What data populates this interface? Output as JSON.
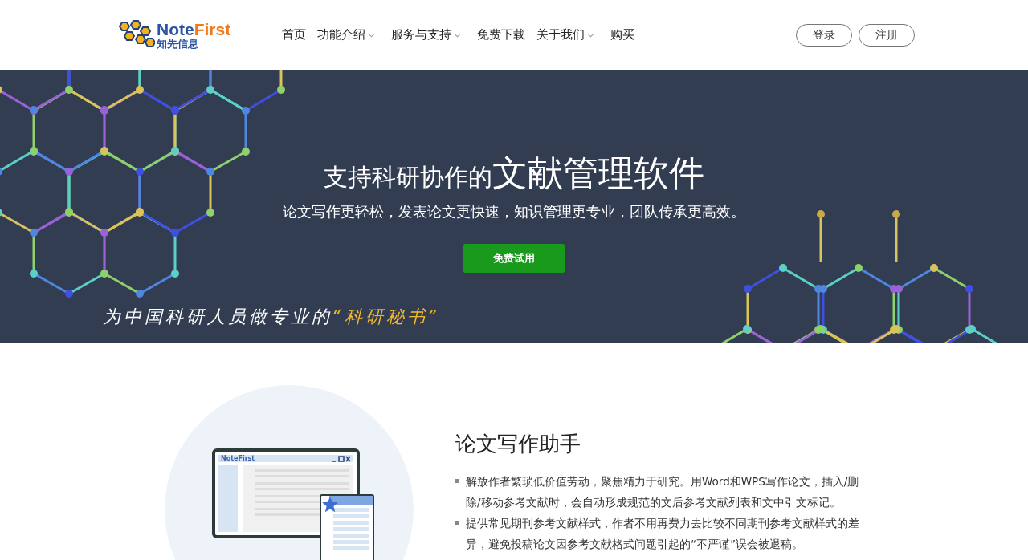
{
  "header": {
    "logo": {
      "name_part1": "Note",
      "name_part2": "First",
      "subtitle": "知先信息"
    },
    "nav": [
      {
        "label": "首页",
        "has_dropdown": false
      },
      {
        "label": "功能介绍",
        "has_dropdown": true
      },
      {
        "label": "服务与支持",
        "has_dropdown": true
      },
      {
        "label": "免费下载",
        "has_dropdown": false
      },
      {
        "label": "关于我们",
        "has_dropdown": true
      },
      {
        "label": "购买",
        "has_dropdown": false
      }
    ],
    "buttons": [
      "登录",
      "注册"
    ]
  },
  "banner": {
    "title_lead": "支持科研协作的",
    "title_main": "文献管理软件",
    "subtitle": "论文写作更轻松，发表论文更快速，知识管理更专业，团队传承更高效。",
    "cta": "免费试用",
    "slogan": "为中国科研人员做专业的",
    "slogan_highlight": "“科研秘书”"
  },
  "feature": {
    "illustration": {
      "window_title": "NoteFirst"
    },
    "heading": "论文写作助手",
    "bullets": [
      "解放作者繁琐低价值劳动，聚焦精力于研究。用Word和WPS写作论文，插入/删除/移动参考文献时，会自动形成规范的文后参考文献列表和文中引文标记。",
      "提供常见期刊参考文献样式，作者不用再费力去比较不同期刊参考文献样式的差异，避免投稿论文因参考文献格式问题引起的“不严谨”误会被退稿。"
    ]
  }
}
